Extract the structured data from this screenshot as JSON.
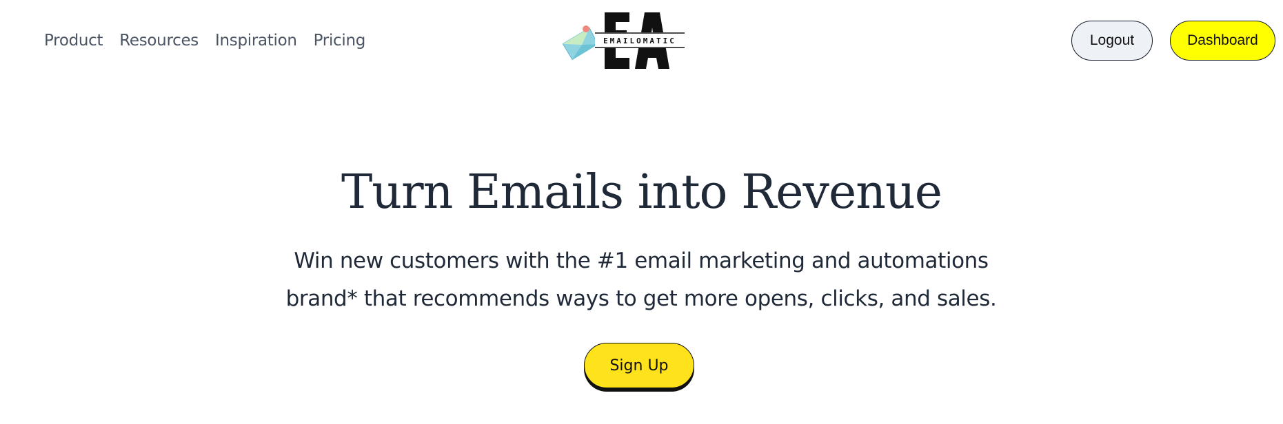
{
  "nav": {
    "items": [
      {
        "label": "Product"
      },
      {
        "label": "Resources"
      },
      {
        "label": "Inspiration"
      },
      {
        "label": "Pricing"
      }
    ]
  },
  "logo": {
    "icon": "envelope-logo-icon",
    "letters": "EA",
    "wordmark": "EMAILOMATIC"
  },
  "header": {
    "logout_label": "Logout",
    "dashboard_label": "Dashboard"
  },
  "hero": {
    "title": "Turn Emails into Revenue",
    "subtitle_line1": "Win new customers with the #1 email marketing and automations",
    "subtitle_line2": "brand* that recommends ways to get more opens, clicks, and sales.",
    "cta_label": "Sign Up"
  },
  "colors": {
    "dashboard_bg": "#ffff00",
    "signup_bg": "#fde21c",
    "logout_bg": "#eef2f6",
    "text": "#1f2937"
  }
}
